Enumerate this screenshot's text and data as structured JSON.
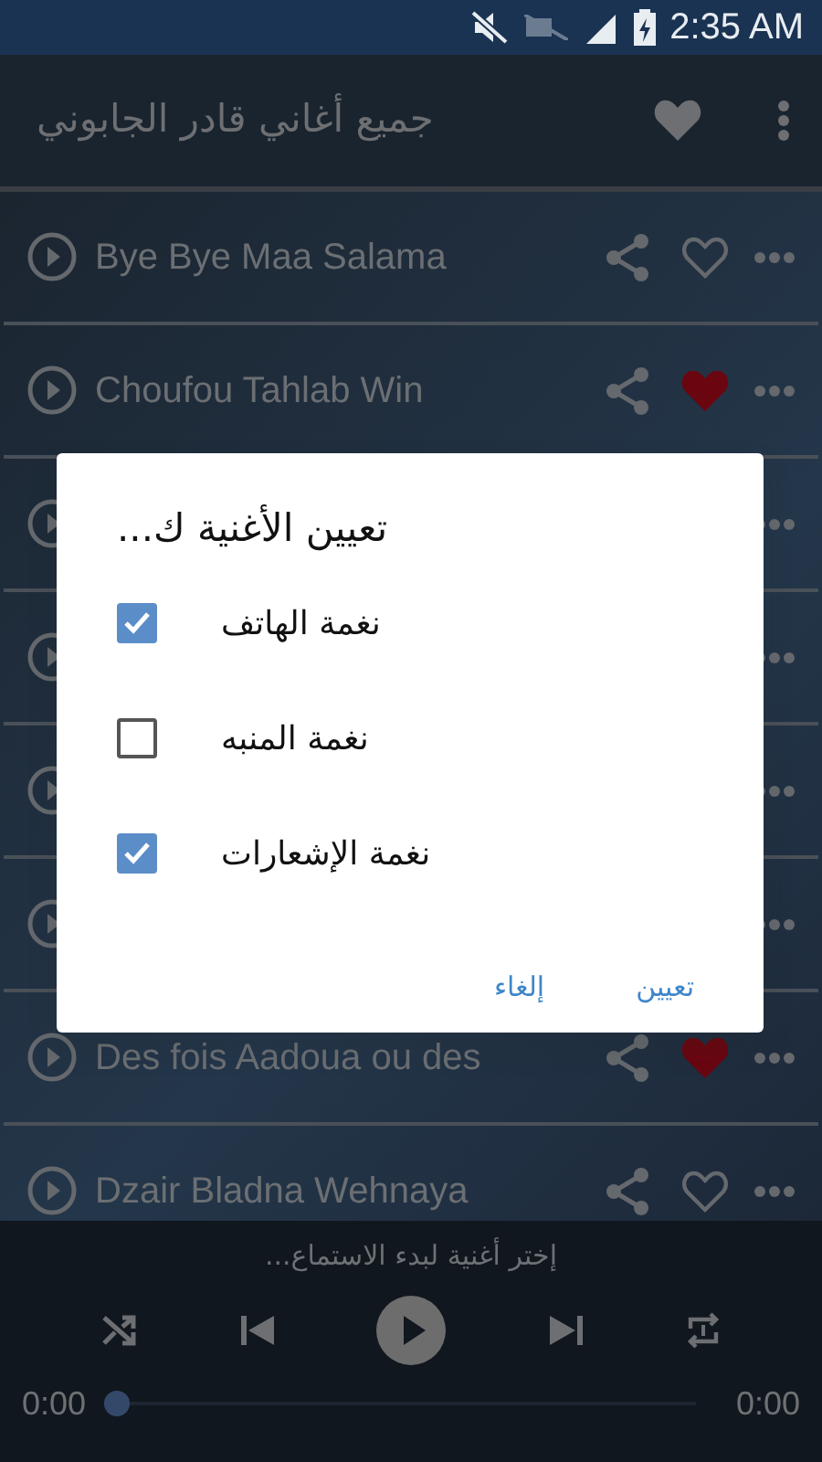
{
  "status_bar": {
    "time": "2:35 AM"
  },
  "app_bar": {
    "title": "جميع أغاني قادر الجابوني"
  },
  "songs": [
    {
      "title": "Bye Bye Maa Salama",
      "favorite": false
    },
    {
      "title": "Choufou Tahlab Win",
      "favorite": true
    },
    {
      "title": "Des fois Aadoua ou des",
      "favorite": true
    },
    {
      "title": "Dzair Bladna Wehnaya",
      "favorite": false
    }
  ],
  "dialog": {
    "title": "تعيين الأغنية ك...",
    "options": [
      {
        "label": "نغمة الهاتف",
        "checked": true
      },
      {
        "label": "نغمة المنبه",
        "checked": false
      },
      {
        "label": "نغمة الإشعارات",
        "checked": true
      }
    ],
    "buttons": [
      "تعيين",
      "إلغاء"
    ]
  },
  "player": {
    "prompt": "إختر أغنية لبدء الاستماع...",
    "elapsed": "0:00",
    "level": 0,
    "duration": "0:00"
  }
}
